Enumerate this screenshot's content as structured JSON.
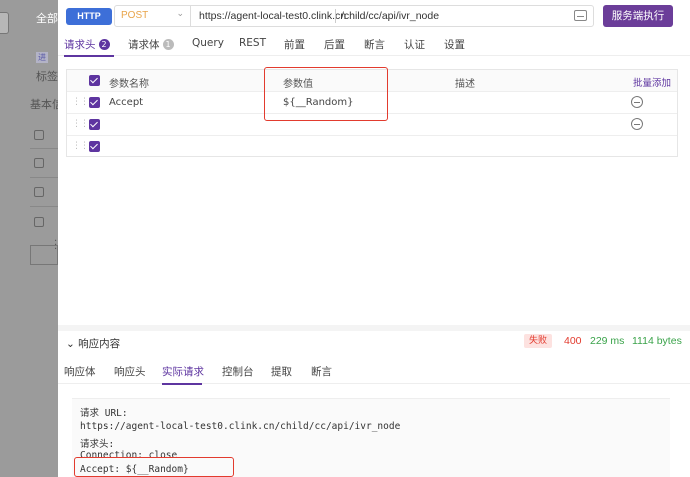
{
  "background": {
    "tab_all": "全部",
    "tag_text": "进",
    "label_text": "标签",
    "side_text": "基本信"
  },
  "topbar": {
    "protocol": "HTTP",
    "method": "POST",
    "url_base": "https://agent-local-test0.clink.cn",
    "url_path": "/child/cc/api/ivr_node",
    "execute_button": "服务端执行"
  },
  "request_tabs": [
    {
      "label": "请求头",
      "badge": "2"
    },
    {
      "label": "请求体",
      "badge": "1"
    },
    {
      "label": "Query"
    },
    {
      "label": "REST"
    },
    {
      "label": "前置"
    },
    {
      "label": "后置"
    },
    {
      "label": "断言"
    },
    {
      "label": "认证"
    },
    {
      "label": "设置"
    }
  ],
  "params_table": {
    "headers": {
      "name": "参数名称",
      "value": "参数值",
      "desc": "描述",
      "bulk": "批量添加"
    },
    "rows": [
      {
        "name": "Accept",
        "value": "${__Random}"
      },
      {
        "name": "",
        "value": ""
      },
      {
        "name": "",
        "value": ""
      }
    ]
  },
  "response": {
    "title": "响应内容",
    "status_label": "失败",
    "status_code": "400",
    "time": "229 ms",
    "size": "1114 bytes",
    "tabs": [
      "响应体",
      "响应头",
      "实际请求",
      "控制台",
      "提取",
      "断言"
    ]
  },
  "actual_request": {
    "lines": [
      "请求 URL:",
      "https://agent-local-test0.clink.cn/child/cc/api/ivr_node",
      "请求头:",
      "Connection: close",
      "Accept: ${__Random}"
    ]
  },
  "colors": {
    "accent": "#5e35a0",
    "protocol": "#3d6fd8",
    "method": "#e8a44a",
    "error": "#e23b2e",
    "success": "#3aa34a",
    "highlight_box": "#e23b2e"
  }
}
